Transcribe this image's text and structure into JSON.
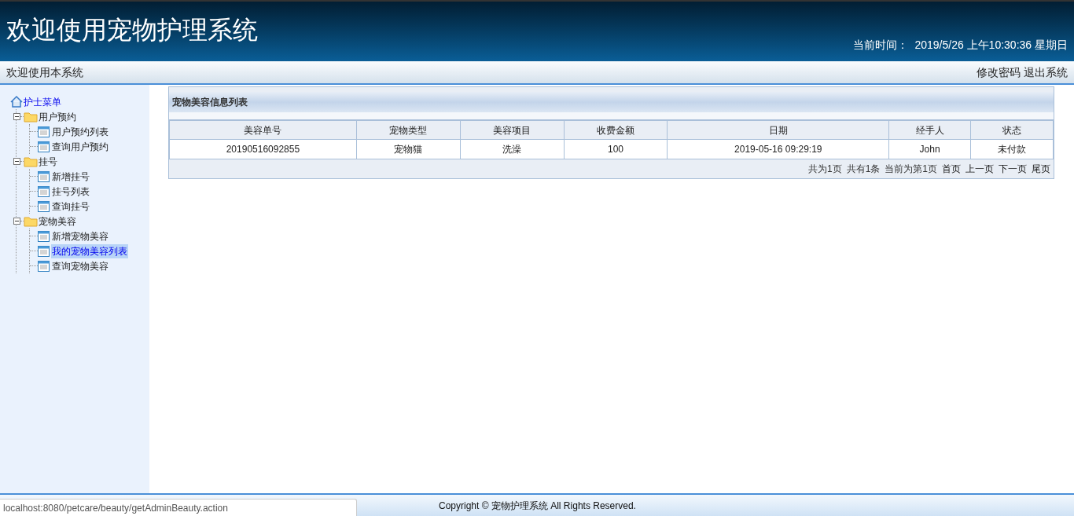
{
  "header": {
    "title": "欢迎使用宠物护理系统",
    "time_label": "当前时间：",
    "time_value": "2019/5/26 上午10:30:36 星期日"
  },
  "nav": {
    "welcome": "欢迎使用本系统",
    "links": [
      "修改密码",
      "退出系统"
    ]
  },
  "sidebar": {
    "root": "护士菜单",
    "groups": [
      {
        "label": "用户预约",
        "expanded": true,
        "children": [
          {
            "label": "用户预约列表",
            "selected": false
          },
          {
            "label": "查询用户预约",
            "selected": false
          }
        ]
      },
      {
        "label": "挂号",
        "expanded": true,
        "children": [
          {
            "label": "新增挂号",
            "selected": false
          },
          {
            "label": "挂号列表",
            "selected": false
          },
          {
            "label": "查询挂号",
            "selected": false
          }
        ]
      },
      {
        "label": "宠物美容",
        "expanded": true,
        "children": [
          {
            "label": "新增宠物美容",
            "selected": false
          },
          {
            "label": "我的宠物美容列表",
            "selected": true
          },
          {
            "label": "查询宠物美容",
            "selected": false
          }
        ]
      }
    ]
  },
  "panel": {
    "title": "宠物美容信息列表",
    "table": {
      "columns": [
        "美容单号",
        "宠物类型",
        "美容项目",
        "收费金额",
        "日期",
        "经手人",
        "状态"
      ],
      "rows": [
        [
          "20190516092855",
          "宠物猫",
          "洗澡",
          "100",
          "2019-05-16 09:29:19",
          "John",
          "未付款"
        ]
      ]
    },
    "pagination": [
      {
        "kind": "info",
        "text": "共为1页"
      },
      {
        "kind": "info",
        "text": "共有1条"
      },
      {
        "kind": "info",
        "text": "当前为第1页"
      },
      {
        "kind": "link",
        "text": "首页"
      },
      {
        "kind": "link",
        "text": "上一页"
      },
      {
        "kind": "link",
        "text": "下一页"
      },
      {
        "kind": "link",
        "text": "尾页"
      }
    ]
  },
  "footer": {
    "copyright": "Copyright © 宠物护理系统 All Rights Reserved.",
    "status_url": "localhost:8080/petcare/beauty/getAdminBeauty.action"
  }
}
